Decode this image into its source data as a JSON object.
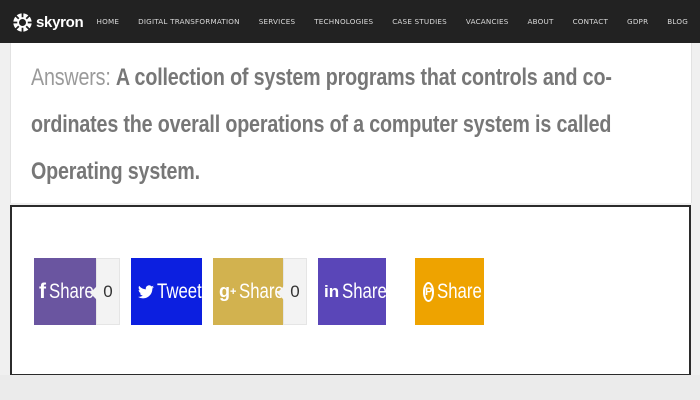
{
  "brand": {
    "name": "skyron"
  },
  "nav": {
    "items": [
      "HOME",
      "DIGITAL TRANSFORMATION",
      "SERVICES",
      "TECHNOLOGIES",
      "CASE STUDIES",
      "VACANCIES",
      "ABOUT",
      "CONTACT",
      "GDPR",
      "BLOG"
    ]
  },
  "answer": {
    "label": "Answers:",
    "text": "A collection of system programs that controls and co-ordinates the overall operations of a computer system is called Operating system."
  },
  "share": {
    "facebook": {
      "icon": "facebook-icon",
      "label": "Share",
      "count": "0",
      "color": "#6a55a0"
    },
    "twitter": {
      "icon": "twitter-icon",
      "label": "Tweet",
      "color": "#0c1fe0"
    },
    "google": {
      "icon": "google-plus-icon",
      "label": "Share",
      "count": "0",
      "color": "#d2b24f"
    },
    "linkedin": {
      "icon": "linkedin-icon",
      "label": "Share",
      "color": "#5a46b8"
    },
    "pinterest": {
      "icon": "pinterest-icon",
      "label": "Share",
      "color": "#eea300"
    }
  }
}
